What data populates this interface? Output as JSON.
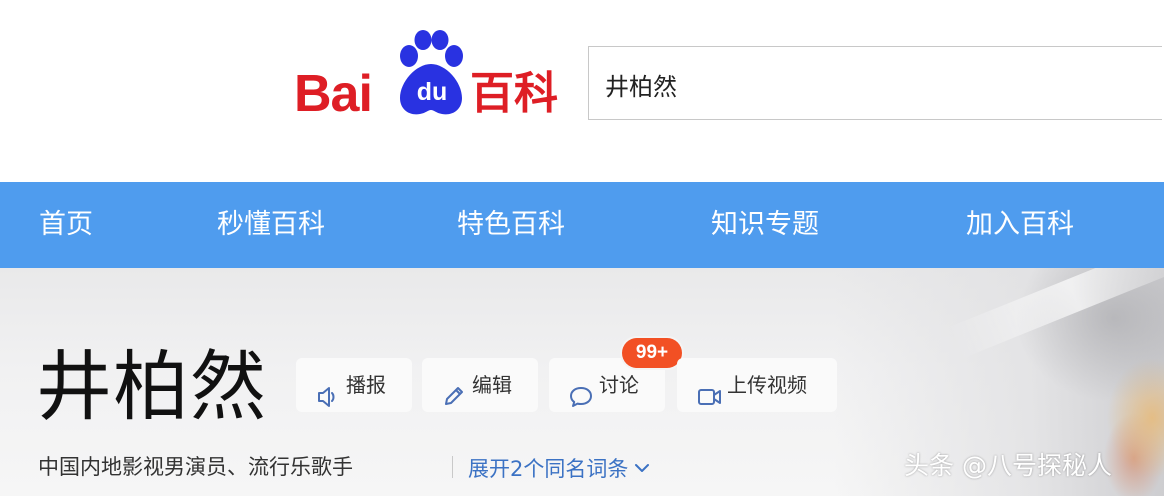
{
  "logo": {
    "brand_text": "Bai",
    "paw_text": "du",
    "product_text": "百科",
    "color": "#de1e25",
    "paw_color": "#2932e1"
  },
  "search": {
    "value": "井柏然"
  },
  "nav": {
    "items": [
      {
        "label": "首页"
      },
      {
        "label": "秒懂百科"
      },
      {
        "label": "特色百科"
      },
      {
        "label": "知识专题"
      },
      {
        "label": "加入百科"
      }
    ],
    "background": "#4f9cee"
  },
  "entry": {
    "title": "井柏然",
    "actions": [
      {
        "label": "播报",
        "icon": "speaker-icon"
      },
      {
        "label": "编辑",
        "icon": "pencil-icon"
      },
      {
        "label": "讨论",
        "icon": "chat-bubble-icon",
        "badge": "99+"
      },
      {
        "label": "上传视频",
        "icon": "video-camera-icon"
      }
    ],
    "description": "中国内地影视男演员、流行乐歌手",
    "expand_label": "展开2个同名词条",
    "link_color": "#3b72c4",
    "badge_color": "#f25024"
  },
  "watermark": "头条 @八号探秘人"
}
